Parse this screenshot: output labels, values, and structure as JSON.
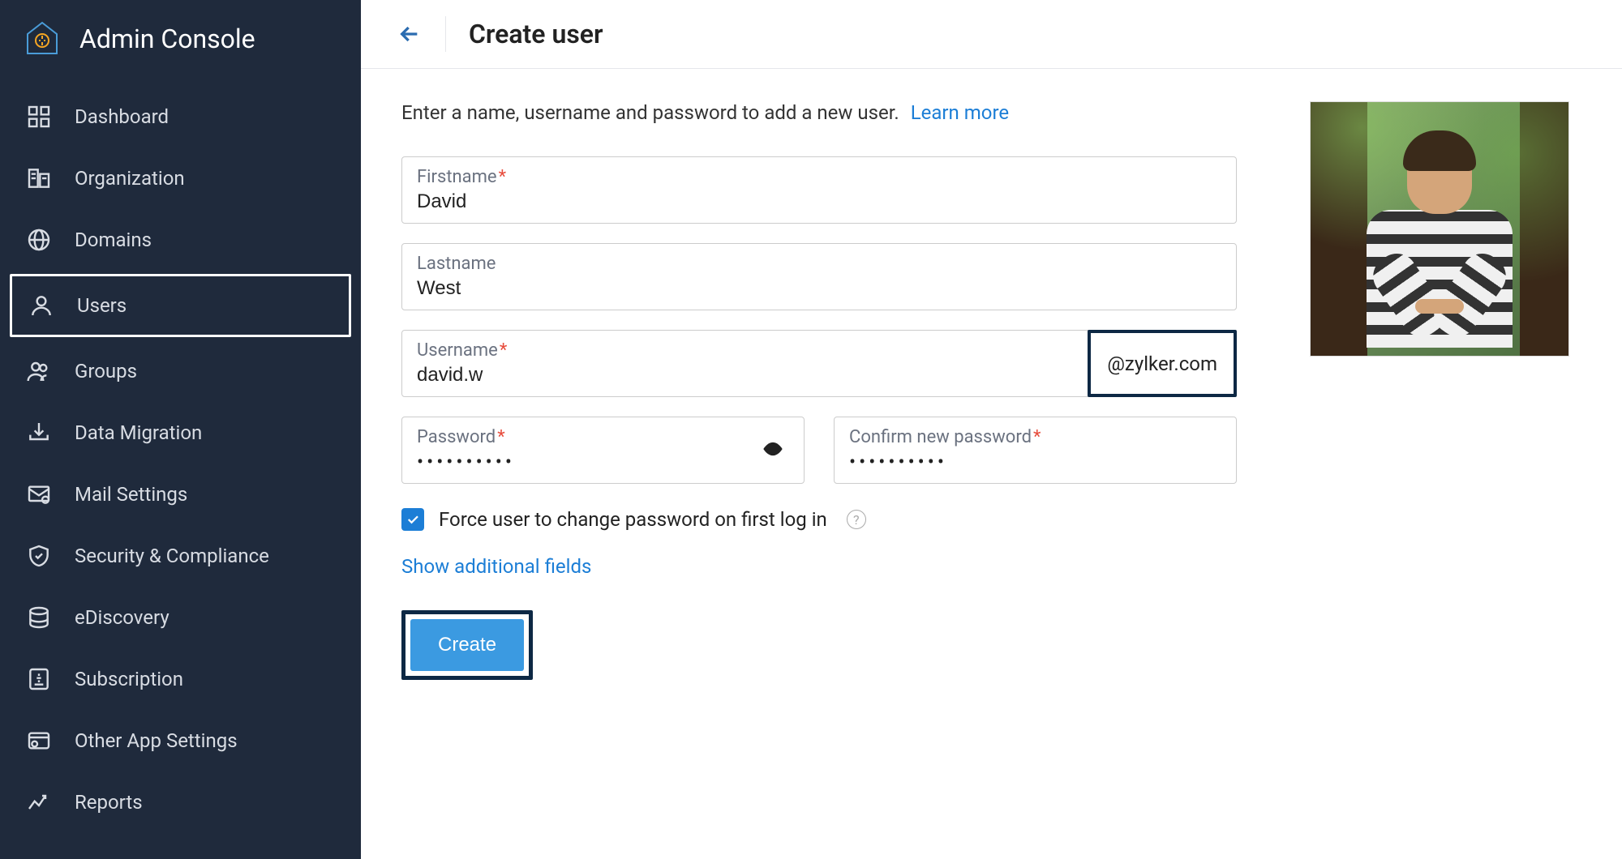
{
  "sidebar": {
    "title": "Admin Console",
    "items": [
      {
        "label": "Dashboard"
      },
      {
        "label": "Organization"
      },
      {
        "label": "Domains"
      },
      {
        "label": "Users"
      },
      {
        "label": "Groups"
      },
      {
        "label": "Data Migration"
      },
      {
        "label": "Mail Settings"
      },
      {
        "label": "Security & Compliance"
      },
      {
        "label": "eDiscovery"
      },
      {
        "label": "Subscription"
      },
      {
        "label": "Other App Settings"
      },
      {
        "label": "Reports"
      }
    ]
  },
  "page": {
    "title": "Create user",
    "intro": "Enter a name, username and password to add a new user.",
    "learn_more": "Learn more"
  },
  "form": {
    "firstname_label": "Firstname",
    "firstname_value": "David",
    "lastname_label": "Lastname",
    "lastname_value": "West",
    "username_label": "Username",
    "username_value": "david.w",
    "domain_suffix": "@zylker.com",
    "password_label": "Password",
    "password_value": "••••••••••",
    "confirm_label": "Confirm new password",
    "confirm_value": "••••••••••",
    "force_change_label": "Force user to change password on first log in",
    "additional_link": "Show additional fields",
    "create_btn": "Create"
  }
}
